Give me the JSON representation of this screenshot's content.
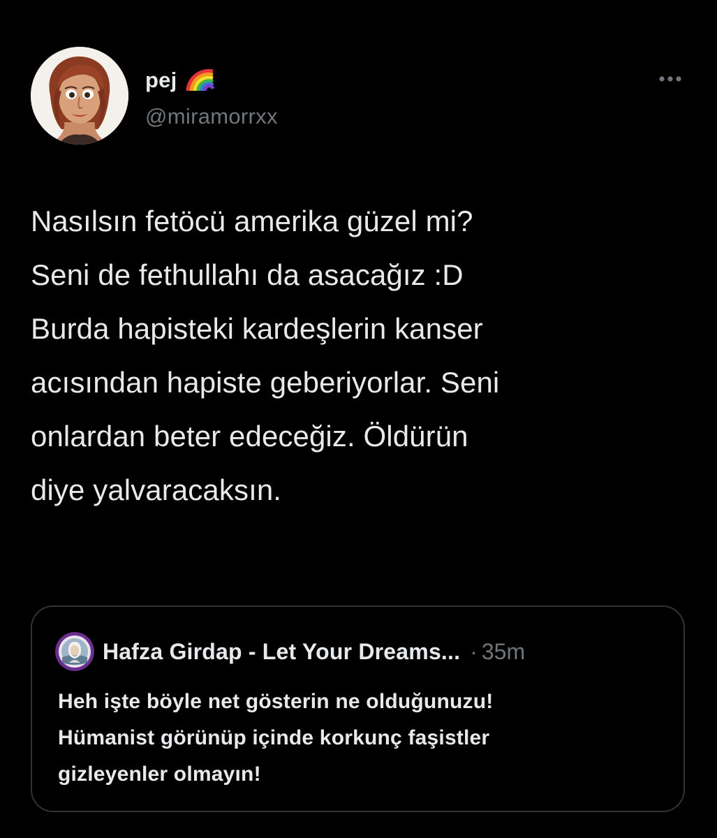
{
  "tweet": {
    "author": {
      "display_name": "pej",
      "emoji_icon": "rainbow-icon",
      "handle": "@miramorrxx",
      "avatar_icon": "cartoon-woman-avatar"
    },
    "more_icon": "more-dots-icon",
    "text": "Nasılsın fetöcü amerika güzel mi?\nSeni de fethullahı da asacağız :D\nBurda hapisteki kardeşlerin kanser\nacısından hapiste geberiyorlar. Seni\nonlardan beter edeceğiz. Öldürün\ndiye yalvaracaksın."
  },
  "quoted_tweet": {
    "author_name": "Hafza Girdap - Let Your Dreams...",
    "separator": "·",
    "time": "35m",
    "avatar_icon": "circular-badge-avatar",
    "text": "Heh işte böyle net gösterin ne olduğunuzu!\nHümanist görünüp içinde korkunç faşistler\ngizleyenler olmayın!"
  },
  "colors": {
    "background": "#000000",
    "primary_text": "#e7e9ea",
    "secondary_text": "#71767b",
    "border": "#2f3336"
  }
}
